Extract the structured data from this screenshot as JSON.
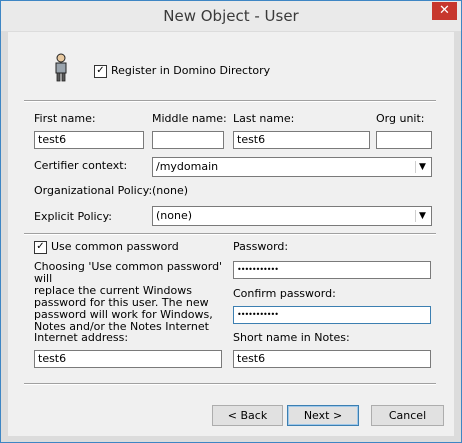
{
  "window": {
    "title": "New Object - User",
    "close_glyph": "✕"
  },
  "register": {
    "label": "Register in Domino Directory",
    "checked": true
  },
  "names": {
    "first_label": "First name:",
    "first_value": "test6",
    "middle_label": "Middle name:",
    "middle_value": "",
    "last_label": "Last name:",
    "last_value": "test6",
    "org_label": "Org unit:",
    "org_value": ""
  },
  "certifier": {
    "label": "Certifier context:",
    "value": "/mydomain"
  },
  "org_policy": {
    "label": "Organizational Policy:",
    "value": "(none)"
  },
  "explicit_policy": {
    "label": "Explicit Policy:",
    "value": "(none)"
  },
  "common_password": {
    "label": "Use common password",
    "checked": true,
    "note_lines": [
      "Choosing 'Use common password' will",
      "replace the current Windows",
      "password for this user.  The new",
      "password will work for Windows,",
      "Notes and/or the Notes Internet"
    ]
  },
  "password": {
    "label": "Password:",
    "value": "•••••••••••"
  },
  "confirm_password": {
    "label": "Confirm password:",
    "value": "•••••••••••"
  },
  "internet_address": {
    "label": "Internet address:",
    "value": "test6"
  },
  "short_name": {
    "label": "Short name in Notes:",
    "value": "test6"
  },
  "buttons": {
    "back": "< Back",
    "next": "Next >",
    "cancel": "Cancel"
  },
  "icons": {
    "user": "user-icon",
    "dropdown": "chevron-down-icon"
  }
}
